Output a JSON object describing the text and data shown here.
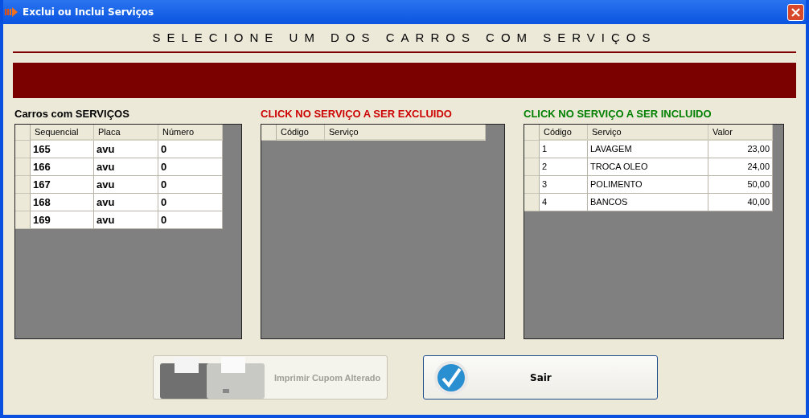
{
  "window": {
    "title": "Exclui ou Inclui Serviços"
  },
  "heading": "SELECIONE UM DOS CARROS COM SERVIÇOS",
  "panels": [
    {
      "title": "Carros com SERVIÇOS",
      "color": "#000000",
      "columns": [
        {
          "label": "Sequencial",
          "kind": "bold"
        },
        {
          "label": "Placa",
          "kind": "bold"
        },
        {
          "label": "Número",
          "kind": "bold"
        }
      ],
      "rows": [
        [
          "165",
          "avu",
          "0"
        ],
        [
          "166",
          "avu",
          "0"
        ],
        [
          "167",
          "avu",
          "0"
        ],
        [
          "168",
          "avu",
          "0"
        ],
        [
          "169",
          "avu",
          "0"
        ]
      ]
    },
    {
      "title": "CLICK NO SERVIÇO A SER EXCLUIDO",
      "color": "#cc0000",
      "columns": [
        {
          "label": "Código"
        },
        {
          "label": "Serviço"
        }
      ]
    },
    {
      "title": "CLICK NO SERVIÇO A SER INCLUIDO",
      "color": "#008000",
      "columns": [
        {
          "label": "Código",
          "kind": "text"
        },
        {
          "label": "Serviço",
          "kind": "text"
        },
        {
          "label": "Valor",
          "kind": "number"
        }
      ],
      "rows": [
        [
          "1",
          "LAVAGEM",
          "23,00"
        ],
        [
          "2",
          "TROCA OLEO",
          "24,00"
        ],
        [
          "3",
          "POLIMENTO",
          "50,00"
        ],
        [
          "4",
          "BANCOS",
          "40,00"
        ]
      ]
    }
  ],
  "buttons": [
    {
      "label": "Imprimir Cupom Alterado",
      "kind": "print",
      "disabled": true
    },
    {
      "label": "Sair",
      "kind": "exit",
      "disabled": false
    }
  ]
}
